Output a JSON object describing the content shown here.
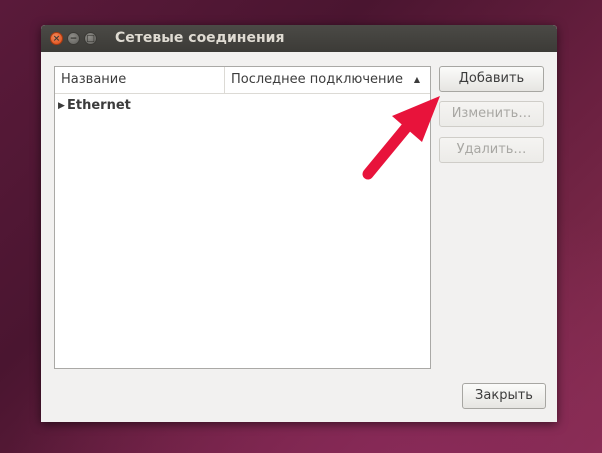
{
  "window": {
    "title": "Сетевые соединения",
    "close_glyph": "×",
    "minimize_glyph": "−",
    "maximize_glyph": "□"
  },
  "connections": {
    "columns": {
      "name": "Название",
      "last_used": "Последнее подключение",
      "sort_indicator": "▲"
    },
    "groups": [
      {
        "expander": "▶",
        "label": "Ethernet"
      }
    ]
  },
  "buttons": {
    "add": "Добавить",
    "edit": "Изменить…",
    "delete": "Удалить…",
    "close": "Закрыть"
  },
  "annotation": {
    "arrow_color": "#e8133b"
  }
}
